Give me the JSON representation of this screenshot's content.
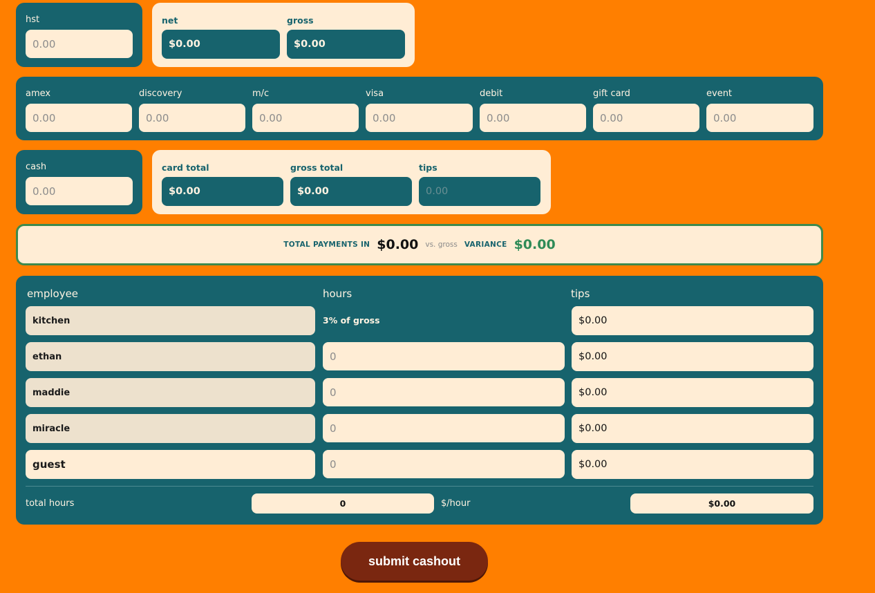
{
  "hst": {
    "label": "hst",
    "placeholder": "0.00"
  },
  "net_gross": {
    "net_label": "net",
    "net_value": "$0.00",
    "gross_label": "gross",
    "gross_value": "$0.00"
  },
  "cards": [
    {
      "label": "amex",
      "placeholder": "0.00"
    },
    {
      "label": "discovery",
      "placeholder": "0.00"
    },
    {
      "label": "m/c",
      "placeholder": "0.00"
    },
    {
      "label": "visa",
      "placeholder": "0.00"
    },
    {
      "label": "debit",
      "placeholder": "0.00"
    },
    {
      "label": "gift card",
      "placeholder": "0.00"
    },
    {
      "label": "event",
      "placeholder": "0.00"
    }
  ],
  "cash": {
    "label": "cash",
    "placeholder": "0.00"
  },
  "totals": {
    "card_total_label": "card total",
    "card_total_value": "$0.00",
    "gross_total_label": "gross total",
    "gross_total_value": "$0.00",
    "tips_label": "tips",
    "tips_placeholder": "0.00"
  },
  "summary": {
    "payments_label": "TOTAL PAYMENTS IN",
    "payments_value": "$0.00",
    "vs_label": "vs. gross",
    "variance_label": "VARIANCE",
    "variance_value": "$0.00",
    "variance_color": "#2E8B57"
  },
  "employees": {
    "headers": {
      "employee": "employee",
      "hours": "hours",
      "tips": "tips"
    },
    "rows": [
      {
        "name": "kitchen",
        "hours_text": "3% of gross",
        "tips": "$0.00"
      },
      {
        "name": "ethan",
        "hours_placeholder": "0",
        "tips": "$0.00"
      },
      {
        "name": "maddie",
        "hours_placeholder": "0",
        "tips": "$0.00"
      },
      {
        "name": "miracle",
        "hours_placeholder": "0",
        "tips": "$0.00"
      },
      {
        "name": "guest",
        "hours_placeholder": "0",
        "tips": "$0.00"
      }
    ],
    "footer": {
      "total_hours_label": "total hours",
      "total_hours_value": "0",
      "per_hour_label": "$/hour",
      "per_hour_value": "$0.00"
    }
  },
  "submit_label": "submit cashout",
  "colors": {
    "background": "#FF7F00",
    "teal": "#17636D",
    "cream": "#FFEDD5",
    "submit": "#7A2710"
  }
}
